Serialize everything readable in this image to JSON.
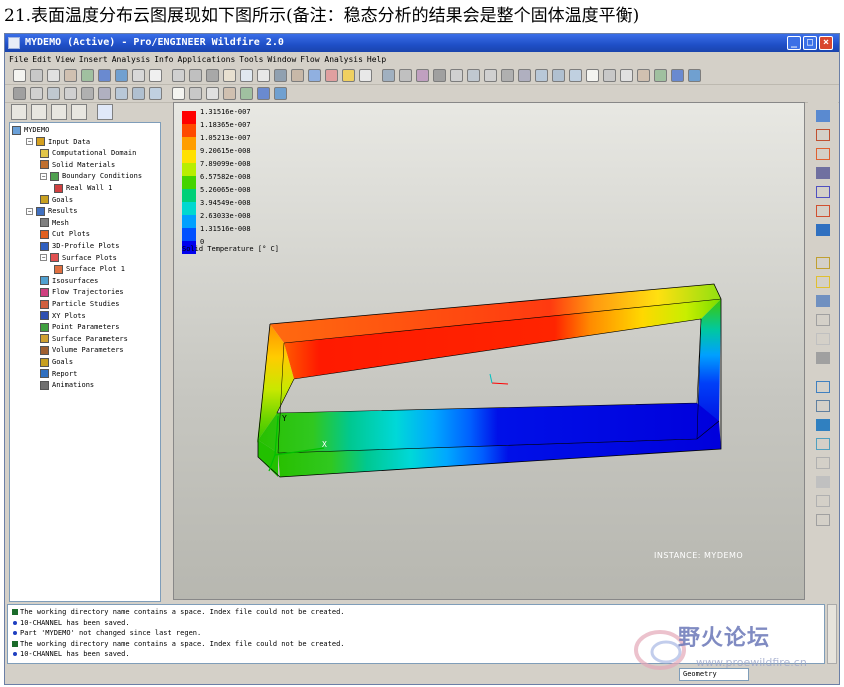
{
  "caption": "21.表面温度分布云图展现如下图所示(备注：稳态分析的结果会是整个固体温度平衡)",
  "window": {
    "title": "MYDEMO (Active) - Pro/ENGINEER Wildfire 2.0",
    "controls": {
      "minimize": "_",
      "maximize": "□",
      "close": "×"
    }
  },
  "menubar": [
    "File",
    "Edit",
    "View",
    "Insert",
    "Analysis",
    "Info",
    "Applications",
    "Tools",
    "Window",
    "Flow Analysis",
    "Help"
  ],
  "tree": [
    {
      "label": "MYDEMO",
      "level": 0,
      "expander": "",
      "icon_color": "#6aa0d8"
    },
    {
      "label": "Input Data",
      "level": 1,
      "expander": "−",
      "icon_color": "#d4a020"
    },
    {
      "label": "Computational Domain",
      "level": 2,
      "expander": "",
      "icon_color": "#e2c64a"
    },
    {
      "label": "Solid Materials",
      "level": 2,
      "expander": "",
      "icon_color": "#c07030"
    },
    {
      "label": "Boundary Conditions",
      "level": 2,
      "expander": "−",
      "icon_color": "#50a050"
    },
    {
      "label": "Real Wall 1",
      "level": 3,
      "expander": "",
      "icon_color": "#d04040"
    },
    {
      "label": "Goals",
      "level": 2,
      "expander": "",
      "icon_color": "#c8a020"
    },
    {
      "label": "Results",
      "level": 1,
      "expander": "−",
      "icon_color": "#4070c0"
    },
    {
      "label": "Mesh",
      "level": 2,
      "expander": "",
      "icon_color": "#808080"
    },
    {
      "label": "Cut Plots",
      "level": 2,
      "expander": "",
      "icon_color": "#e06020"
    },
    {
      "label": "3D-Profile Plots",
      "level": 2,
      "expander": "",
      "icon_color": "#3060c0"
    },
    {
      "label": "Surface Plots",
      "level": 2,
      "expander": "−",
      "icon_color": "#e05050"
    },
    {
      "label": "Surface Plot 1",
      "level": 3,
      "expander": "",
      "icon_color": "#e07040"
    },
    {
      "label": "Isosurfaces",
      "level": 2,
      "expander": "",
      "icon_color": "#50a0d0"
    },
    {
      "label": "Flow Trajectories",
      "level": 2,
      "expander": "",
      "icon_color": "#d04080"
    },
    {
      "label": "Particle Studies",
      "level": 2,
      "expander": "",
      "icon_color": "#d06040"
    },
    {
      "label": "XY Plots",
      "level": 2,
      "expander": "",
      "icon_color": "#3050b0"
    },
    {
      "label": "Point Parameters",
      "level": 2,
      "expander": "",
      "icon_color": "#40a040"
    },
    {
      "label": "Surface Parameters",
      "level": 2,
      "expander": "",
      "icon_color": "#d0a030"
    },
    {
      "label": "Volume Parameters",
      "level": 2,
      "expander": "",
      "icon_color": "#a06030"
    },
    {
      "label": "Goals",
      "level": 2,
      "expander": "",
      "icon_color": "#c8a020"
    },
    {
      "label": "Report",
      "level": 2,
      "expander": "",
      "icon_color": "#3070c0"
    },
    {
      "label": "Animations",
      "level": 2,
      "expander": "",
      "icon_color": "#707070"
    }
  ],
  "legend": {
    "title": "Solid Temperature [° C]",
    "levels": [
      {
        "label": "1.31516e-007",
        "color": "#ff0000"
      },
      {
        "label": "1.18365e-007",
        "color": "#ff4a00"
      },
      {
        "label": "1.05213e-007",
        "color": "#ff9e00"
      },
      {
        "label": "9.20615e-008",
        "color": "#ffe000"
      },
      {
        "label": "7.89099e-008",
        "color": "#b8ee00"
      },
      {
        "label": "6.57582e-008",
        "color": "#44d400"
      },
      {
        "label": "5.26065e-008",
        "color": "#00d078"
      },
      {
        "label": "3.94549e-008",
        "color": "#00d8d0"
      },
      {
        "label": "2.63033e-008",
        "color": "#00a0ff"
      },
      {
        "label": "1.31516e-008",
        "color": "#0050ff"
      },
      {
        "label": "0",
        "color": "#0000ee"
      }
    ]
  },
  "viewport": {
    "instance_label": "INSTANCE: MYDEMO",
    "axis_labels": {
      "x": "X",
      "y": "Y"
    }
  },
  "messages": [
    {
      "type": "info",
      "text": "The working directory name contains a space. Index file could not be created."
    },
    {
      "type": "bullet",
      "text": "10-CHANNEL has been saved."
    },
    {
      "type": "bullet",
      "text": "Part 'MYDEMO' not changed since last regen."
    },
    {
      "type": "info",
      "text": "The working directory name contains a space. Index file could not be created."
    },
    {
      "type": "bullet",
      "text": "10-CHANNEL has been saved."
    }
  ],
  "statusbar": {
    "filter": "Geometry"
  },
  "watermark": {
    "text": "野火论坛",
    "url": "www.proewildfire.cn"
  }
}
